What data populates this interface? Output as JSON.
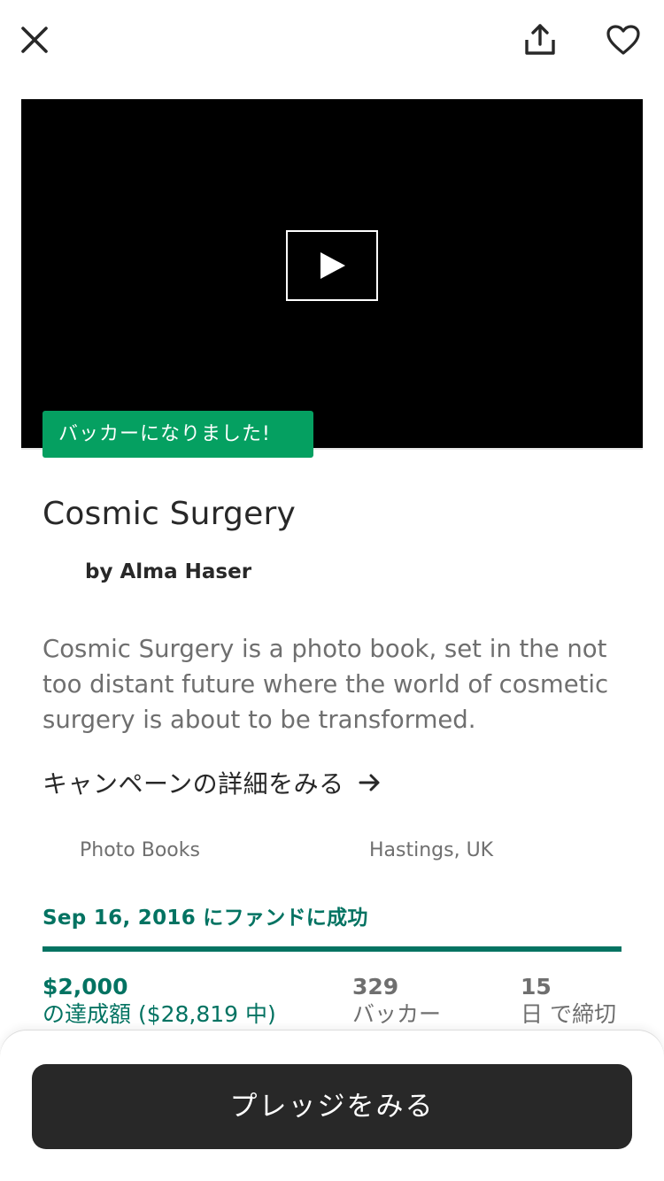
{
  "header": {
    "close_icon": "close-icon",
    "share_icon": "share-icon",
    "favorite_icon": "heart-icon"
  },
  "media": {
    "play_icon": "play-icon",
    "backer_badge": "バッカーになりました!"
  },
  "project": {
    "title": "Cosmic Surgery",
    "creator": "by Alma Haser",
    "blurb": "Cosmic Surgery is a photo book, set in the not too distant future where the world of cosmetic surgery is about to be transformed.",
    "campaign_link": "キャンペーンの詳細をみる",
    "category": "Photo Books",
    "location": "Hastings, UK"
  },
  "funding": {
    "status": "Sep 16, 2016 にファンドに成功",
    "progress_fraction": 1.0,
    "pledged_value": "$2,000",
    "pledged_label": "の達成額 ($28,819 中)",
    "backers_value": "329",
    "backers_label": "バッカー",
    "days_value": "15",
    "days_label": "日 で締切"
  },
  "footer": {
    "pledge_button": "プレッジをみる"
  },
  "colors": {
    "accent_green": "#037362",
    "badge_green": "#05a061",
    "button_dark": "#282828"
  }
}
